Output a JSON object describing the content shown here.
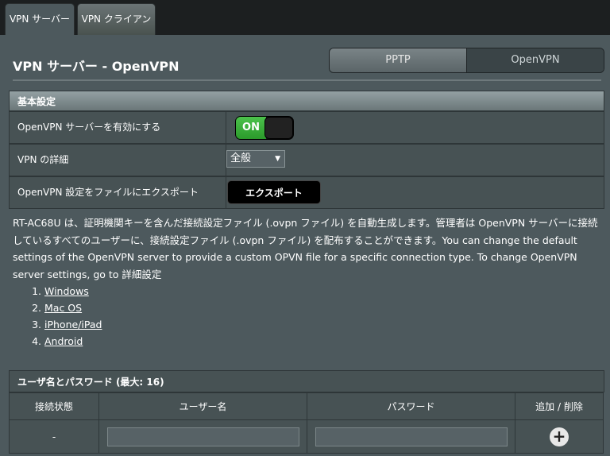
{
  "tabs": [
    {
      "label": "VPN サーバー"
    },
    {
      "label": "VPN クライアント"
    }
  ],
  "page_title": "VPN サーバー - OpenVPN",
  "segment": {
    "pptp": "PPTP",
    "openvpn": "OpenVPN"
  },
  "basic": {
    "header": "基本設定",
    "enable_label": "OpenVPN サーバーを有効にする",
    "toggle_on": "ON",
    "detail_label": "VPN の詳細",
    "detail_value": "全般",
    "export_label": "OpenVPN 設定をファイルにエクスポート",
    "export_button": "エクスポート"
  },
  "description": "RT-AC68U は、証明機関キーを含んだ接続設定ファイル (.ovpn ファイル) を自動生成します。管理者は OpenVPN サーバーに接続しているすべてのユーザーに、接続設定ファイル (.ovpn ファイル) を配布することができます。You can change the default settings of the OpenVPN server to provide a custom OPVN file for a specific connection type. To change OpenVPN server settings, go to 詳細設定",
  "os_links": [
    "Windows",
    "Mac OS",
    "iPhone/iPad",
    "Android"
  ],
  "users": {
    "header": "ユーザ名とパスワード (最大: 16)",
    "col_status": "接続状態",
    "col_username": "ユーザー名",
    "col_password": "パスワード",
    "col_action": "追加 / 削除",
    "row_status": "-"
  },
  "colors": {
    "toggle_on": "#2b9a2b",
    "panel": "#4d595d"
  }
}
